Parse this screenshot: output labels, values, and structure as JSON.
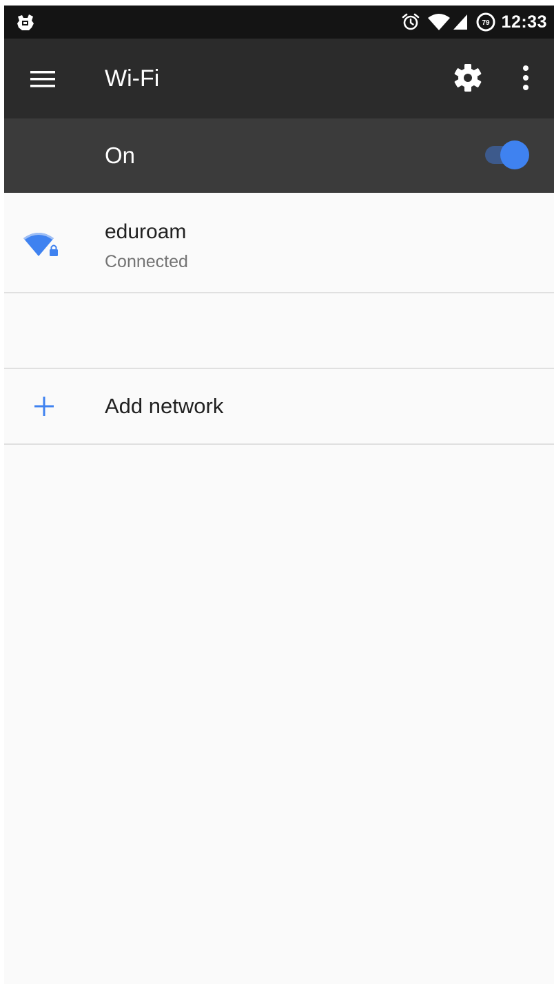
{
  "status_bar": {
    "time": "12:33",
    "left_icon": "notification-app-icon",
    "icons": [
      "alarm-icon",
      "wifi-signal-icon",
      "cell-signal-icon",
      "battery-icon"
    ],
    "battery_level": "79"
  },
  "toolbar": {
    "title": "Wi-Fi",
    "menu_icon": "hamburger-menu-icon",
    "settings_icon": "gear-icon",
    "overflow_icon": "more-vertical-icon"
  },
  "wifi_toggle": {
    "label": "On",
    "state": true,
    "color": "#3f82f0"
  },
  "networks": [
    {
      "name": "eduroam",
      "status": "Connected",
      "icon": "wifi-locked-icon"
    }
  ],
  "add_network": {
    "label": "Add network",
    "icon": "plus-icon"
  },
  "colors": {
    "accent": "#3f82f0",
    "toolbar": "#2b2b2b",
    "switch_bar": "#3b3b3b",
    "status_bar": "#141414",
    "background": "#fafafa"
  }
}
